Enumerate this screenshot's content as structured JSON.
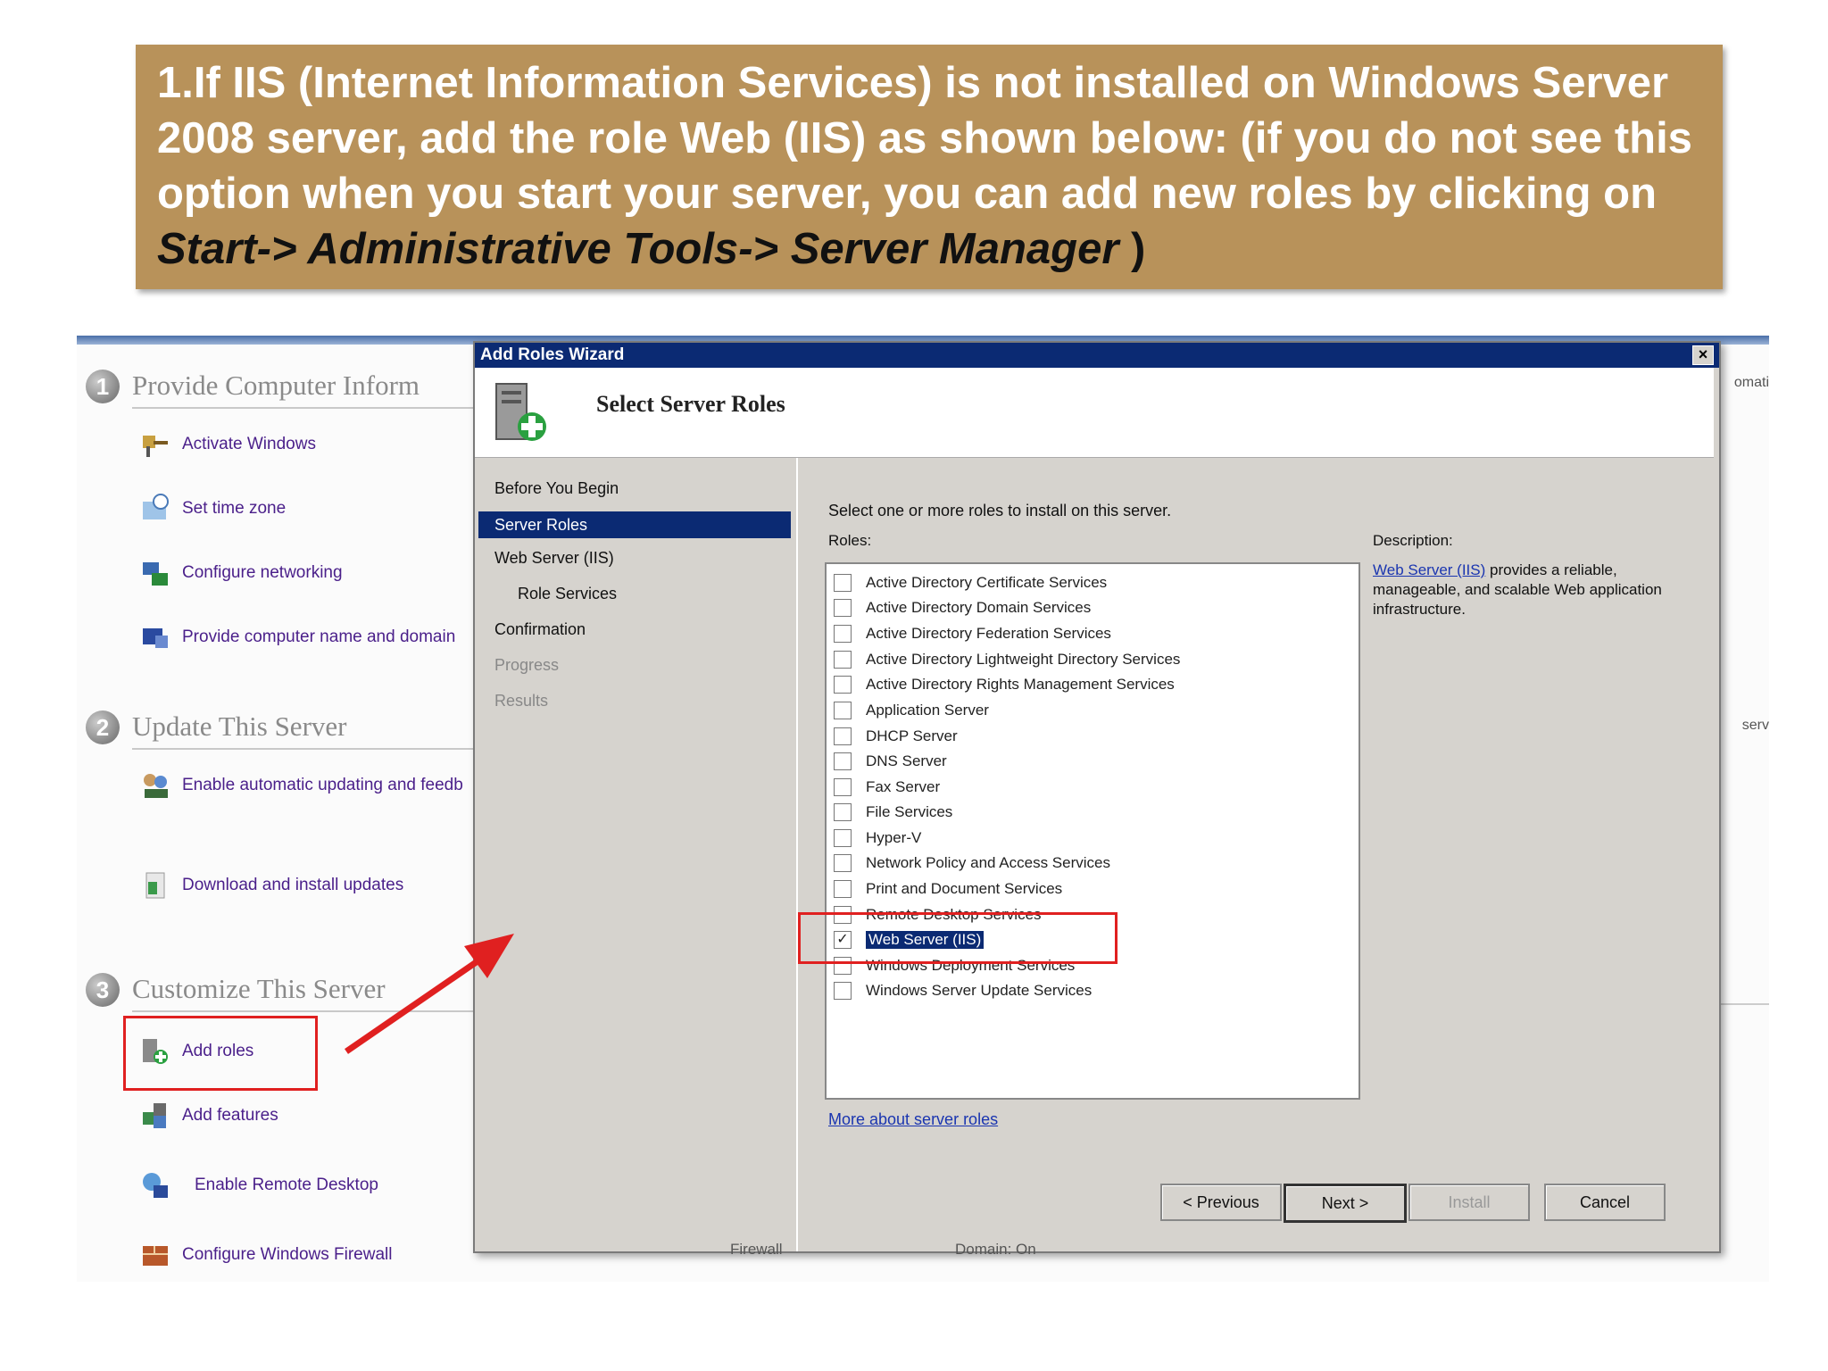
{
  "banner": {
    "text_plain": "1.If IIS (Internet Information Services) is not installed on Windows Server 2008 server, add the role Web (IIS) as shown below: (if you do not see this option when you start your server, you can add new roles by clicking on ",
    "text_path": "Start-> Administrative Tools-> Server Manager",
    "text_close": " )"
  },
  "background_window": {
    "sections": [
      {
        "num": "1",
        "title": "Provide Computer Inform",
        "tasks": [
          "Activate Windows",
          "Set time zone",
          "Configure networking",
          "Provide computer name and domain"
        ]
      },
      {
        "num": "2",
        "title": "Update This Server",
        "tasks": [
          "Enable automatic updating and feedb",
          "Download and install updates"
        ]
      },
      {
        "num": "3",
        "title": "Customize This Server",
        "tasks": [
          "Add roles",
          "Add features",
          "Enable Remote Desktop",
          "Configure Windows Firewall"
        ]
      }
    ],
    "right_stub_1": "omati",
    "right_stub_2": "serv",
    "below_firewall": "Firewall",
    "below_domain": "Domain: On"
  },
  "dialog": {
    "title": "Add Roles Wizard",
    "close": "×",
    "header_title": "Select Server Roles",
    "steps": [
      "Before You Begin",
      "Server Roles",
      "Web Server (IIS)",
      "Role Services",
      "Confirmation",
      "Progress",
      "Results"
    ],
    "instruction": "Select one or more roles to install on this server.",
    "roles_label": "Roles:",
    "roles": [
      "Active Directory Certificate Services",
      "Active Directory Domain Services",
      "Active Directory Federation Services",
      "Active Directory Lightweight Directory Services",
      "Active Directory Rights Management Services",
      "Application Server",
      "DHCP Server",
      "DNS Server",
      "Fax Server",
      "File Services",
      "Hyper-V",
      "Network Policy and Access Services",
      "Print and Document Services",
      "Remote Desktop Services",
      "Web Server (IIS)",
      "Windows Deployment Services",
      "Windows Server Update Services"
    ],
    "checked_mark": "✓",
    "description_label": "Description:",
    "description_link": "Web Server (IIS)",
    "description_rest": " provides a reliable, manageable, and scalable Web application infrastructure.",
    "more_link": "More about server roles",
    "buttons": {
      "previous": "< Previous",
      "next": "Next >",
      "install": "Install",
      "cancel": "Cancel"
    }
  },
  "colors": {
    "banner": "#b8925a",
    "highlight": "#e02020",
    "titlebar": "#0b2a73"
  }
}
